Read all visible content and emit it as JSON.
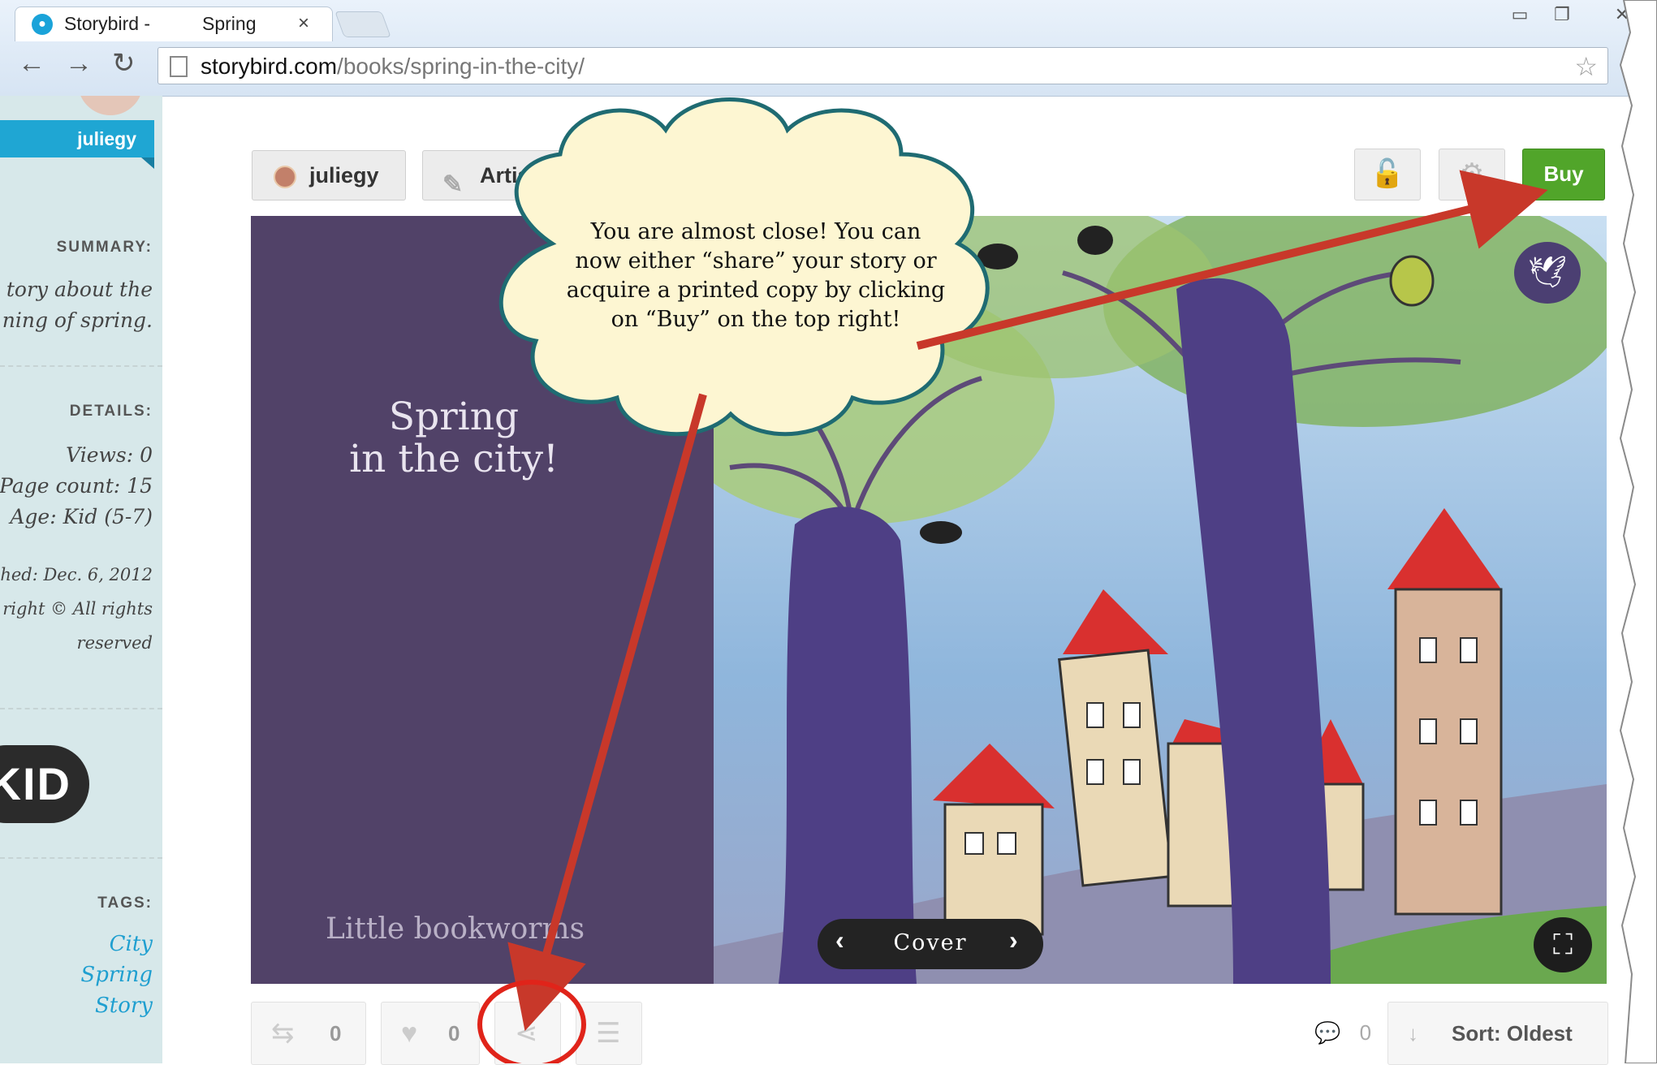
{
  "browser": {
    "tab_title": "Storybird -",
    "tab_title_suffix": "Spring",
    "tab_close": "×",
    "url_domain": "storybird.com",
    "url_path": "/books/spring-in-the-city/"
  },
  "sidebar": {
    "username": "juliegy",
    "summary_label": "SUMMARY:",
    "summary_line1": "tory about the",
    "summary_line2": "ning of spring.",
    "details_label": "DETAILS:",
    "views": "Views: 0",
    "page_count": "Page count: 15",
    "age": "Age: Kid (5-7)",
    "published": "hed: Dec. 6, 2012",
    "copyright_line1": "right © All rights",
    "copyright_line2": "reserved",
    "kid_badge": "KID",
    "tags_label": "TAGS:",
    "tags": [
      "City",
      "Spring",
      "Story"
    ]
  },
  "toolbar": {
    "author_label": "juliegy",
    "artist_label": "Artist",
    "buy_label": "Buy"
  },
  "book": {
    "title_line1": "Spring",
    "title_line2": "in the city!",
    "publisher": "Little bookworms",
    "page_label": "Cover"
  },
  "bottom_bar": {
    "remix_count": "0",
    "favorite_count": "0",
    "comment_count": "0",
    "sort_label": "Sort: Oldest"
  },
  "annotation": {
    "text": "You are almost close! You can now either “share” your story or acquire a printed copy by clicking on “Buy” on the top right!"
  },
  "colors": {
    "buy_green": "#51a52a",
    "sidebar_blue": "#1fa6d3",
    "cover_purple": "#514268",
    "arrow_red": "#c8382a"
  }
}
